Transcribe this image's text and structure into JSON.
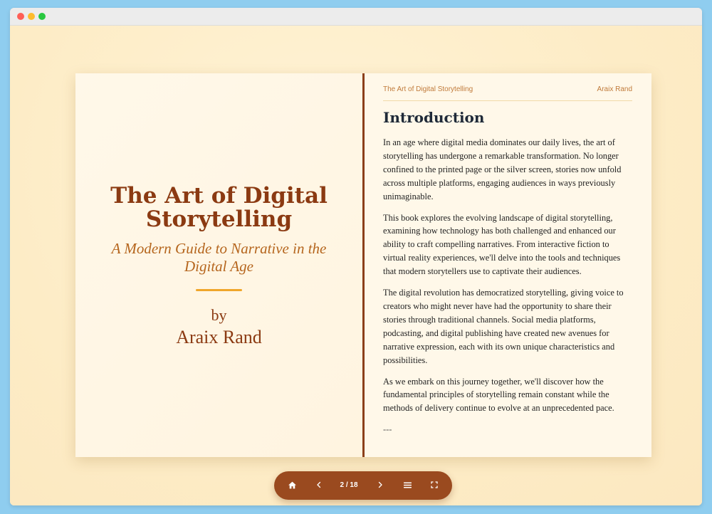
{
  "book": {
    "title": "The Art of Digital Storytelling",
    "subtitle": "A Modern Guide to Narrative in the Digital Age",
    "by_label": "by",
    "author": "Araix Rand"
  },
  "page": {
    "running_title": "The Art of Digital Storytelling",
    "running_author": "Araix Rand",
    "chapter_title": "Introduction",
    "paragraphs": [
      "In an age where digital media dominates our daily lives, the art of storytelling has undergone a remarkable transformation. No longer confined to the printed page or the silver screen, stories now unfold across multiple platforms, engaging audiences in ways previously unimaginable.",
      "This book explores the evolving landscape of digital storytelling, examining how technology has both challenged and enhanced our ability to craft compelling narratives. From interactive fiction to virtual reality experiences, we'll delve into the tools and techniques that modern storytellers use to captivate their audiences.",
      "The digital revolution has democratized storytelling, giving voice to creators who might never have had the opportunity to share their stories through traditional channels. Social media platforms, podcasting, and digital publishing have created new avenues for narrative expression, each with its own unique characteristics and possibilities.",
      "As we embark on this journey together, we'll discover how the fundamental principles of storytelling remain constant while the methods of delivery continue to evolve at an unprecedented pace."
    ],
    "separator": "---"
  },
  "controls": {
    "page_indicator": "2 / 18",
    "icons": [
      "home-icon",
      "chevron-left-icon",
      "chevron-right-icon",
      "menu-icon",
      "fullscreen-icon"
    ]
  },
  "colors": {
    "spine": "#8b3f1a",
    "title": "#8b3a12",
    "subtitle": "#b5651d",
    "accent": "#f0a62a",
    "control_bar": "#9a4a1f"
  }
}
